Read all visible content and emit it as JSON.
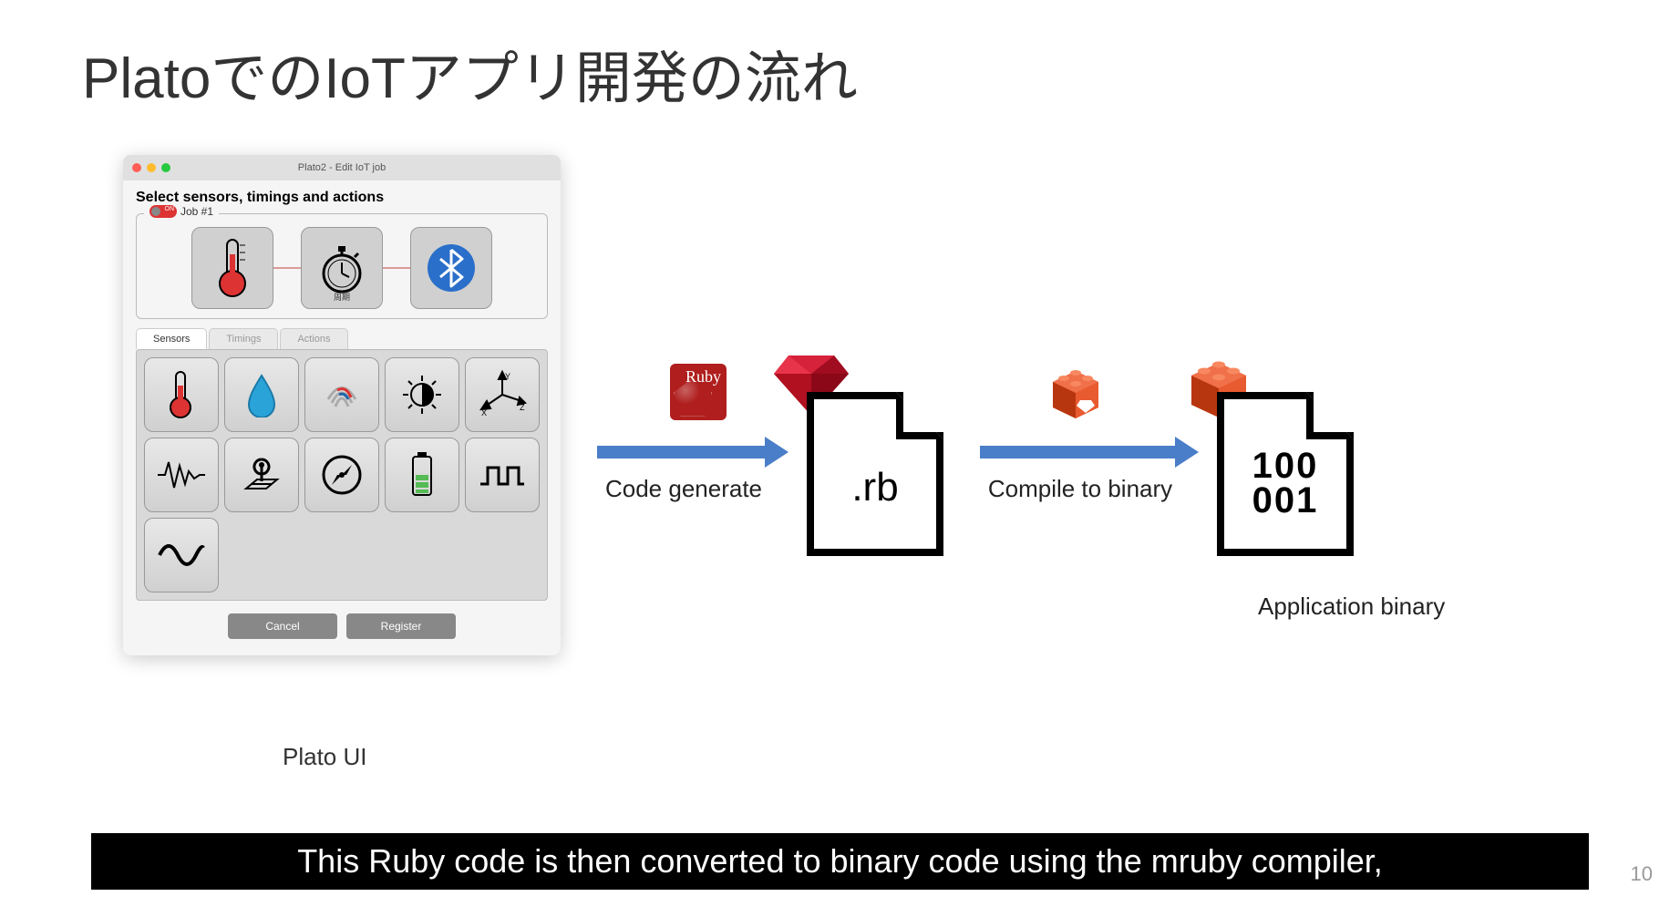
{
  "title": "PlatoでのIoTアプリ開発の流れ",
  "window": {
    "title": "Plato2 - Edit IoT job",
    "heading": "Select sensors, timings and actions",
    "job_label": "Job #1",
    "toggle_state": "ON",
    "job_tiles": [
      {
        "name": "thermometer",
        "label": ""
      },
      {
        "name": "stopwatch",
        "label": "周期"
      },
      {
        "name": "bluetooth",
        "label": ""
      }
    ],
    "tabs": [
      {
        "label": "Sensors",
        "active": true
      },
      {
        "label": "Timings",
        "active": false
      },
      {
        "label": "Actions",
        "active": false
      }
    ],
    "sensors": [
      "thermometer",
      "humidity-drop",
      "fingerprint",
      "brightness",
      "axes",
      "vibration",
      "gps-pin",
      "compass",
      "battery",
      "digital-pulse",
      "analog-wave"
    ],
    "buttons": {
      "cancel": "Cancel",
      "register": "Register"
    }
  },
  "captions": {
    "plato_ui": "Plato UI",
    "app_binary": "Application binary"
  },
  "flow": {
    "step1": {
      "label": "Code generate",
      "badge": "Ruby"
    },
    "rb_file": ".rb",
    "step2": {
      "label": "Compile to binary"
    },
    "binary_content": [
      "100",
      "001"
    ]
  },
  "subtitle": "This Ruby code is then converted to binary code using the mruby compiler,",
  "page": "10"
}
